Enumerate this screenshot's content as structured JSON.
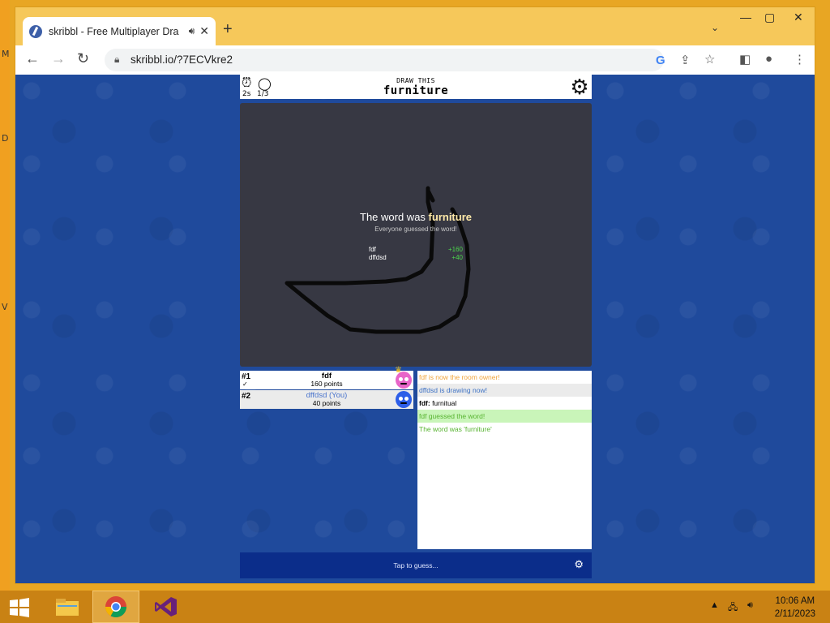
{
  "browser": {
    "tab_title": "skribbl - Free Multiplayer Dra",
    "url": "skribbl.io/?7ECVkre2",
    "icons": {
      "audio": "speaker-icon",
      "close": "close-icon",
      "new_tab": "plus-icon",
      "back": "back-arrow-icon",
      "forward": "forward-arrow-icon",
      "reload": "reload-icon",
      "lock": "lock-icon",
      "google": "G",
      "share": "share-icon",
      "bookmark": "star-icon",
      "sidebar": "sidepanel-icon",
      "profile": "profile-icon",
      "menu": "kebab-menu-icon"
    }
  },
  "desktop": {
    "edge_letters": [
      "M",
      "D",
      "V"
    ]
  },
  "game": {
    "timer": "2s",
    "round": "1/3",
    "draw_label": "DRAW THIS",
    "word": "furniture",
    "overlay": {
      "title_prefix": "The word was",
      "title_word": "furniture",
      "subtitle": "Everyone guessed the word!",
      "scores": [
        {
          "name": "fdf",
          "points": "+160"
        },
        {
          "name": "dffdsd",
          "points": "+40"
        }
      ]
    },
    "players": [
      {
        "rank": "#1",
        "name": "fdf",
        "points": "160 points",
        "avatar_color": "#e865c9"
      },
      {
        "rank": "#2",
        "name": "dffdsd (You)",
        "points": "40 points",
        "avatar_color": "#2d5ee8"
      }
    ],
    "chat": {
      "msg1": "fdf is now the room owner!",
      "msg2": "dffdsd is drawing now!",
      "msg3_name": "fdf:",
      "msg3_text": "furnitual",
      "msg4": "fdf guessed the word!",
      "msg5": "The word was 'furniture'"
    },
    "guess_placeholder": "Tap to guess..."
  },
  "taskbar": {
    "time": "10:06 AM",
    "date": "2/11/2023"
  },
  "colors": {
    "page_bg": "#1f4a9c",
    "canvas_bg": "#373843",
    "guess_bar": "#0b2d8a",
    "taskbar": "#c98214"
  }
}
